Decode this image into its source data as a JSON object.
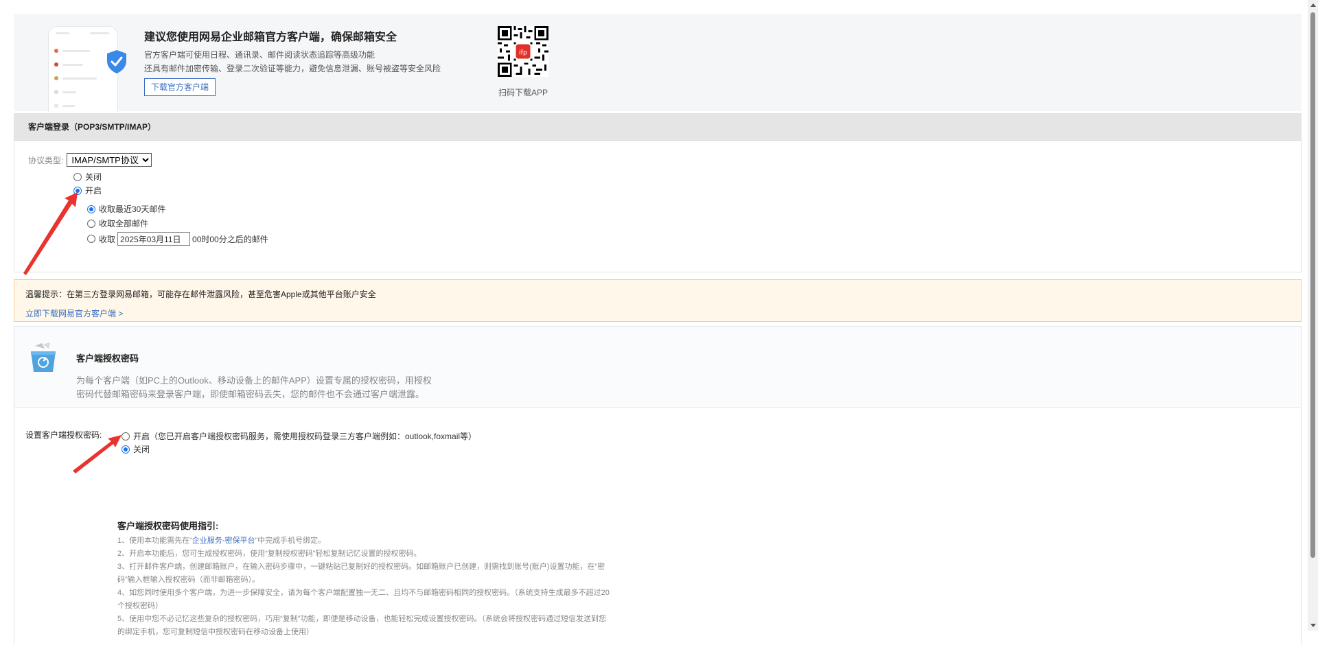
{
  "promo": {
    "title": "建议您使用网易企业邮箱官方客户端，确保邮箱安全",
    "desc_line1": "官方客户端可使用日程、通讯录、邮件阅读状态追踪等高级功能",
    "desc_line2": "还具有邮件加密传输、登录二次验证等能力，避免信息泄漏、账号被盗等安全风险",
    "download_button": "下载官方客户端",
    "qr_label": "扫码下载APP",
    "qr_logo_text": "ifp"
  },
  "login": {
    "header": "客户端登录（POP3/SMTP/IMAP）",
    "protocol_label": "协议类型:",
    "protocol_selected": "IMAP/SMTP协议",
    "option_off": "关闭",
    "option_on": "开启",
    "option_on_selected": true,
    "fetch_recent": "收取最近30天邮件",
    "fetch_all": "收取全部邮件",
    "fetch_from_prefix": "收取",
    "fetch_from_date": "2025年03月11日",
    "fetch_from_suffix": "00时00分之后的邮件"
  },
  "warning": {
    "text": "温馨提示：在第三方登录网易邮箱，可能存在邮件泄露风险，甚至危害Apple或其他平台账户安全",
    "link": "立即下载网易官方客户端 >"
  },
  "auth": {
    "title": "客户端授权密码",
    "desc_line1": "为每个客户端（如PC上的Outlook、移动设备上的邮件APP）设置专属的授权密码，用授权",
    "desc_line2": "密码代替邮箱密码来登录客户端，即使邮箱密码丢失，您的邮件也不会通过客户端泄露。",
    "set_label": "设置客户端授权密码:",
    "option_on": "开启（您已开启客户端授权密码服务，需使用授权码登录三方客户端例如：outlook,foxmail等）",
    "option_off": "关闭"
  },
  "guide": {
    "title": "客户端授权密码使用指引:",
    "item1_prefix": "1、使用本功能需先在“",
    "item1_link": "企业服务-密保平台",
    "item1_suffix": "”中完成手机号绑定。",
    "item2": "2、开启本功能后，您可生成授权密码，使用“复制授权密码”轻松复制记忆设置的授权密码。",
    "item3_line1": "3、打开邮件客户端，创建邮箱账户，在输入密码步骤中，一键粘贴已复制好的授权密码。如邮箱账户已创建，则需找到账号(账户)设置功能，在“密",
    "item3_line2": "码”输入框输入授权密码（而非邮箱密码）。",
    "item4_line1": "4、如您同时使用多个客户端，为进一步保障安全，请为每个客户端配置独一无二、且均不与邮箱密码相同的授权密码。（系统支持生成最多不超过20",
    "item4_line2": "个授权密码）",
    "item5_line1": "5、使用中您不必记忆这些复杂的授权密码，巧用“复制”功能，即便是移动设备，也能轻松完成设置授权密码。（系统会将授权密码通过短信发送到您",
    "item5_line2": "的绑定手机，您可复制短信中授权密码在移动设备上使用）"
  },
  "colors": {
    "accent": "#1a73e8",
    "link": "#3a6fc4",
    "warning_bg": "#fff8ea",
    "warning_border": "#f3cf85",
    "annotation_arrow": "#e8332e"
  }
}
